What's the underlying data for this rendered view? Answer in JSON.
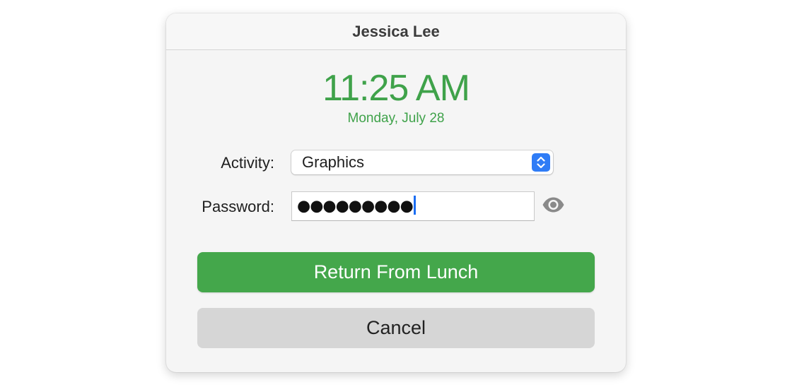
{
  "dialog": {
    "title": "Jessica Lee",
    "time": "11:25 AM",
    "date": "Monday, July 28"
  },
  "form": {
    "activity_label": "Activity:",
    "activity_value": "Graphics",
    "password_label": "Password:",
    "password_masked": "●●●●●●●●●"
  },
  "buttons": {
    "primary_label": "Return From Lunch",
    "cancel_label": "Cancel"
  },
  "icons": {
    "select_stepper": "chevron-up-down-icon",
    "reveal_password": "eye-icon"
  },
  "colors": {
    "accent_green": "#44a74b",
    "time_green": "#3fa24a",
    "stepper_blue": "#2f7cf6",
    "caret_blue": "#1b6ef3"
  }
}
